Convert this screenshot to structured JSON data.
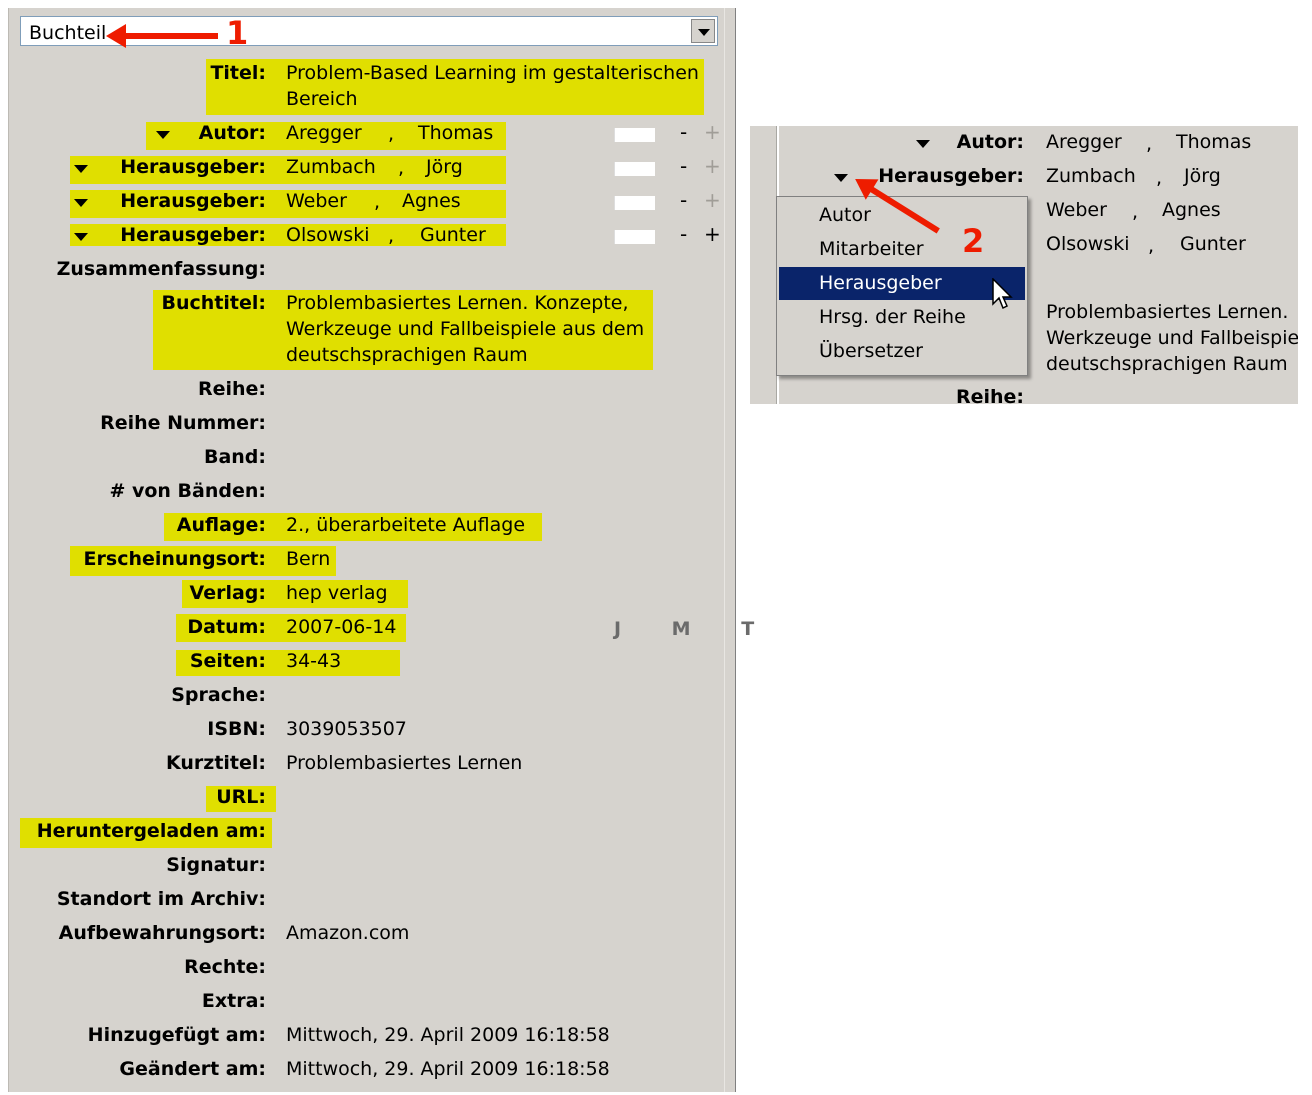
{
  "item_type": "Buchteil",
  "fields": {
    "titel": {
      "label": "Titel:",
      "value": "Problem-Based Learning im gestalterischen Bereich"
    },
    "creators": [
      {
        "role": "Autor:",
        "last": "Aregger",
        "first": "Thomas"
      },
      {
        "role": "Herausgeber:",
        "last": "Zumbach",
        "first": "Jörg"
      },
      {
        "role": "Herausgeber:",
        "last": "Weber",
        "first": "Agnes"
      },
      {
        "role": "Herausgeber:",
        "last": "Olsowski",
        "first": "Gunter"
      }
    ],
    "zusammenfassung": {
      "label": "Zusammenfassung:",
      "value": ""
    },
    "buchtitel": {
      "label": "Buchtitel:",
      "value": "Problembasiertes Lernen. Konzepte, Werkzeuge und Fallbeispiele aus dem deutschsprachigen Raum"
    },
    "reihe": {
      "label": "Reihe:",
      "value": ""
    },
    "reihe_nummer": {
      "label": "Reihe Nummer:",
      "value": ""
    },
    "band": {
      "label": "Band:",
      "value": ""
    },
    "von_baenden": {
      "label": "# von Bänden:",
      "value": ""
    },
    "auflage": {
      "label": "Auflage:",
      "value": "2., überarbeitete Auflage"
    },
    "erscheinungsort": {
      "label": "Erscheinungsort:",
      "value": "Bern"
    },
    "verlag": {
      "label": "Verlag:",
      "value": "hep verlag"
    },
    "datum": {
      "label": "Datum:",
      "value": "2007-06-14",
      "order": "J M T"
    },
    "seiten": {
      "label": "Seiten:",
      "value": "34-43"
    },
    "sprache": {
      "label": "Sprache:",
      "value": ""
    },
    "isbn": {
      "label": "ISBN:",
      "value": "3039053507"
    },
    "kurztitel": {
      "label": "Kurztitel:",
      "value": "Problembasiertes Lernen"
    },
    "url": {
      "label": "URL:",
      "value": ""
    },
    "heruntergeladen": {
      "label": "Heruntergeladen am:",
      "value": ""
    },
    "signatur": {
      "label": "Signatur:",
      "value": ""
    },
    "standort": {
      "label": "Standort im Archiv:",
      "value": ""
    },
    "aufbewahrungsort": {
      "label": "Aufbewahrungsort:",
      "value": "Amazon.com"
    },
    "rechte": {
      "label": "Rechte:",
      "value": ""
    },
    "extra": {
      "label": "Extra:",
      "value": ""
    },
    "hinzugefuegt": {
      "label": "Hinzugefügt am:",
      "value": "Mittwoch, 29. April 2009 16:18:58"
    },
    "geaendert": {
      "label": "Geändert am:",
      "value": "Mittwoch, 29. April 2009 16:18:58"
    }
  },
  "annotations": {
    "one": "1",
    "two": "2",
    "highlight_color": "#e0df00",
    "arrow_color": "#ee1c00"
  },
  "inset": {
    "rows": [
      {
        "role": "Autor:",
        "last": "Aregger",
        "first": "Thomas"
      },
      {
        "role": "Herausgeber:",
        "last": "Zumbach",
        "first": "Jörg"
      },
      {
        "last": "Weber",
        "first": "Agnes"
      },
      {
        "last": "Olsowski",
        "first": "Gunter"
      }
    ],
    "buchtitel_lines": [
      "Problembasiertes Lernen.",
      "Werkzeuge und Fallbeispie",
      "deutschsprachigen Raum"
    ],
    "reihe_label": "Reihe:",
    "menu": [
      "Autor",
      "Mitarbeiter",
      "Herausgeber",
      "Hrsg. der Reihe",
      "Übersetzer"
    ],
    "menu_selected": "Herausgeber",
    "selection_color": "#0a246a"
  }
}
